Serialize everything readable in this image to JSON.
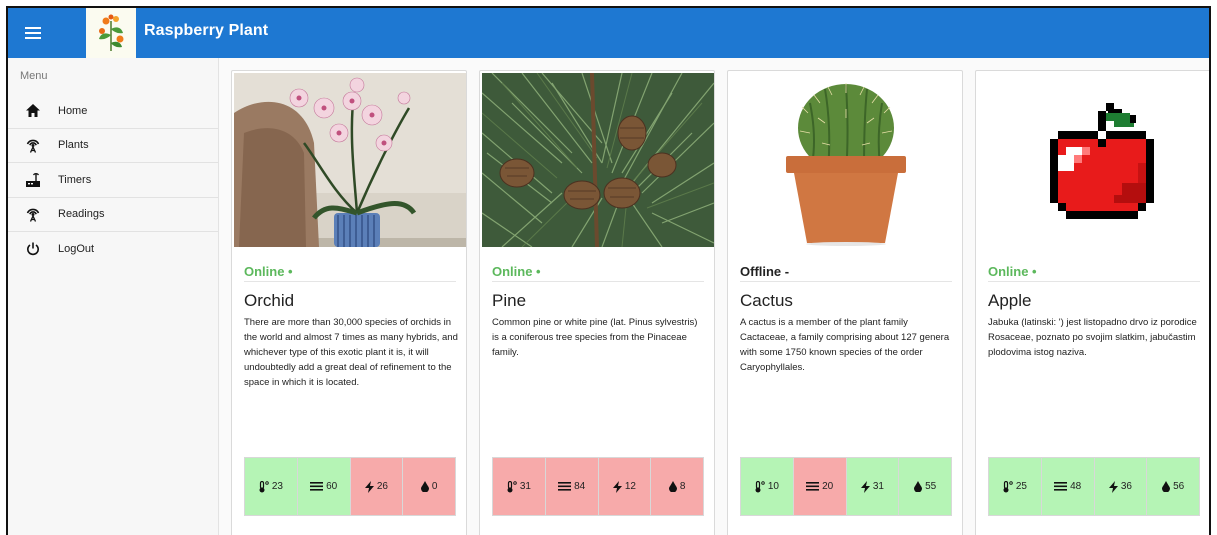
{
  "app": {
    "title": "Raspberry Plant"
  },
  "sidebar": {
    "header": "Menu",
    "items": [
      {
        "label": "Home",
        "icon": "home-icon"
      },
      {
        "label": "Plants",
        "icon": "antenna-icon"
      },
      {
        "label": "Timers",
        "icon": "router-icon"
      },
      {
        "label": "Readings",
        "icon": "antenna-icon"
      },
      {
        "label": "LogOut",
        "icon": "power-icon"
      }
    ]
  },
  "colors": {
    "accent": "#1e78d2",
    "online": "#5cb85c",
    "good": "#b5f4b5",
    "bad": "#f7aaaa"
  },
  "cards": [
    {
      "status": "Online •",
      "online": true,
      "name": "Orchid",
      "description": "There are more than 30,000 species of orchids in the world and almost 7 times as many hybrids, and whichever type of this exotic plant it is, it will undoubtedly add a great deal of refinement to the space in which it is located.",
      "stats": {
        "temperature": "23",
        "humidity": "60",
        "light": "26",
        "moisture": "0"
      },
      "stat_ok": {
        "temperature": true,
        "humidity": true,
        "light": false,
        "moisture": false
      }
    },
    {
      "status": "Online •",
      "online": true,
      "name": "Pine",
      "description": "Common pine or white pine (lat. Pinus sylvestris) is a coniferous tree species from the Pinaceae family.",
      "stats": {
        "temperature": "31",
        "humidity": "84",
        "light": "12",
        "moisture": "8"
      },
      "stat_ok": {
        "temperature": false,
        "humidity": false,
        "light": false,
        "moisture": false
      }
    },
    {
      "status": "Offline -",
      "online": false,
      "name": "Cactus",
      "description": "A cactus is a member of the plant family Cactaceae, a family comprising about 127 genera with some 1750 known species of the order Caryophyllales.",
      "stats": {
        "temperature": "10",
        "humidity": "20",
        "light": "31",
        "moisture": "55"
      },
      "stat_ok": {
        "temperature": true,
        "humidity": false,
        "light": true,
        "moisture": true
      }
    },
    {
      "status": "Online •",
      "online": true,
      "name": "Apple",
      "description": "Jabuka (latinski: ') jest listopadno drvo iz porodice Rosaceae, poznato po svojim slatkim, jabučastim plodovima istog naziva.",
      "stats": {
        "temperature": "25",
        "humidity": "48",
        "light": "36",
        "moisture": "56"
      },
      "stat_ok": {
        "temperature": true,
        "humidity": true,
        "light": true,
        "moisture": true
      }
    }
  ]
}
